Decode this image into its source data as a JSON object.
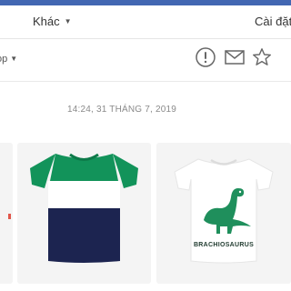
{
  "toolbar": {
    "more_label": "Khác",
    "settings_label": "Cài đặt"
  },
  "actionbar": {
    "left_dropdown_label": "op",
    "icons": [
      "alert-circle-icon",
      "envelope-icon",
      "star-icon"
    ]
  },
  "conversation": {
    "timestamp": "14:24, 31 THÁNG 7, 2019"
  },
  "products": {
    "items": [
      {
        "name": "striped-tshirt",
        "colors": [
          "#12935a",
          "#ffffff",
          "#1c2450"
        ]
      },
      {
        "name": "dinosaur-tshirt",
        "print_text": "BRACHIOSAURUS",
        "colors": [
          "#ffffff",
          "#1f8f5c"
        ]
      }
    ]
  },
  "colors": {
    "accent": "#4267b2",
    "muted_text": "#8a8a8a",
    "card_bg": "#f4f4f4"
  }
}
